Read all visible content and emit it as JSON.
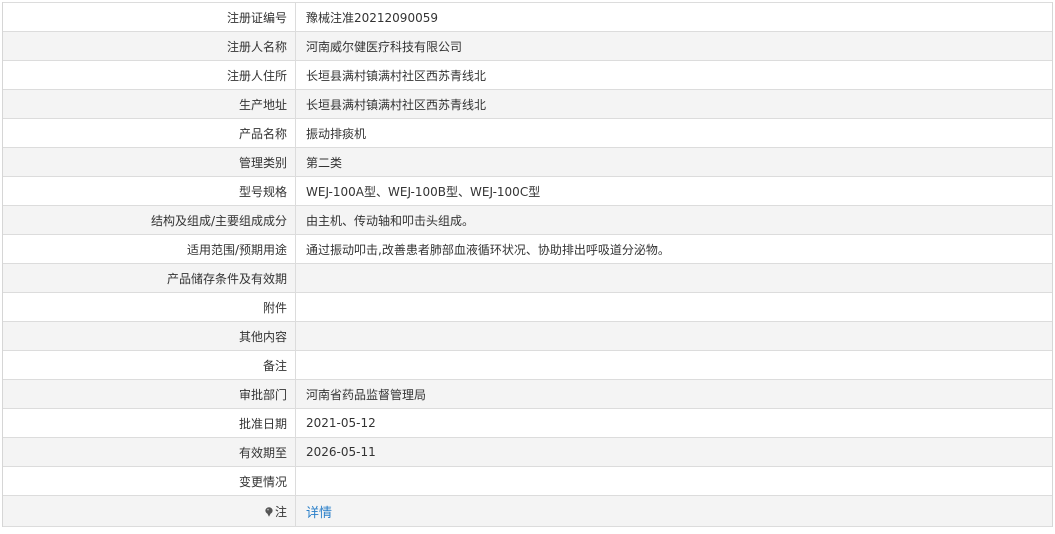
{
  "rows": [
    {
      "label": "注册证编号",
      "value": "豫械注准20212090059"
    },
    {
      "label": "注册人名称",
      "value": "河南威尔健医疗科技有限公司"
    },
    {
      "label": "注册人住所",
      "value": "长垣县满村镇满村社区西苏青线北"
    },
    {
      "label": "生产地址",
      "value": "长垣县满村镇满村社区西苏青线北"
    },
    {
      "label": "产品名称",
      "value": "振动排痰机"
    },
    {
      "label": "管理类别",
      "value": "第二类"
    },
    {
      "label": "型号规格",
      "value": "WEJ-100A型、WEJ-100B型、WEJ-100C型"
    },
    {
      "label": "结构及组成/主要组成成分",
      "value": "由主机、传动轴和叩击头组成。"
    },
    {
      "label": "适用范围/预期用途",
      "value": "通过振动叩击,改善患者肺部血液循环状况、协助排出呼吸道分泌物。"
    },
    {
      "label": "产品储存条件及有效期",
      "value": ""
    },
    {
      "label": "附件",
      "value": ""
    },
    {
      "label": "其他内容",
      "value": ""
    },
    {
      "label": "备注",
      "value": ""
    },
    {
      "label": "审批部门",
      "value": "河南省药品监督管理局"
    },
    {
      "label": "批准日期",
      "value": "2021-05-12"
    },
    {
      "label": "有效期至",
      "value": "2026-05-11"
    },
    {
      "label": "变更情况",
      "value": ""
    }
  ],
  "note": {
    "label": "注",
    "icon": "pin-icon",
    "link_text": "详情",
    "link_color": "#2a7fc9"
  }
}
